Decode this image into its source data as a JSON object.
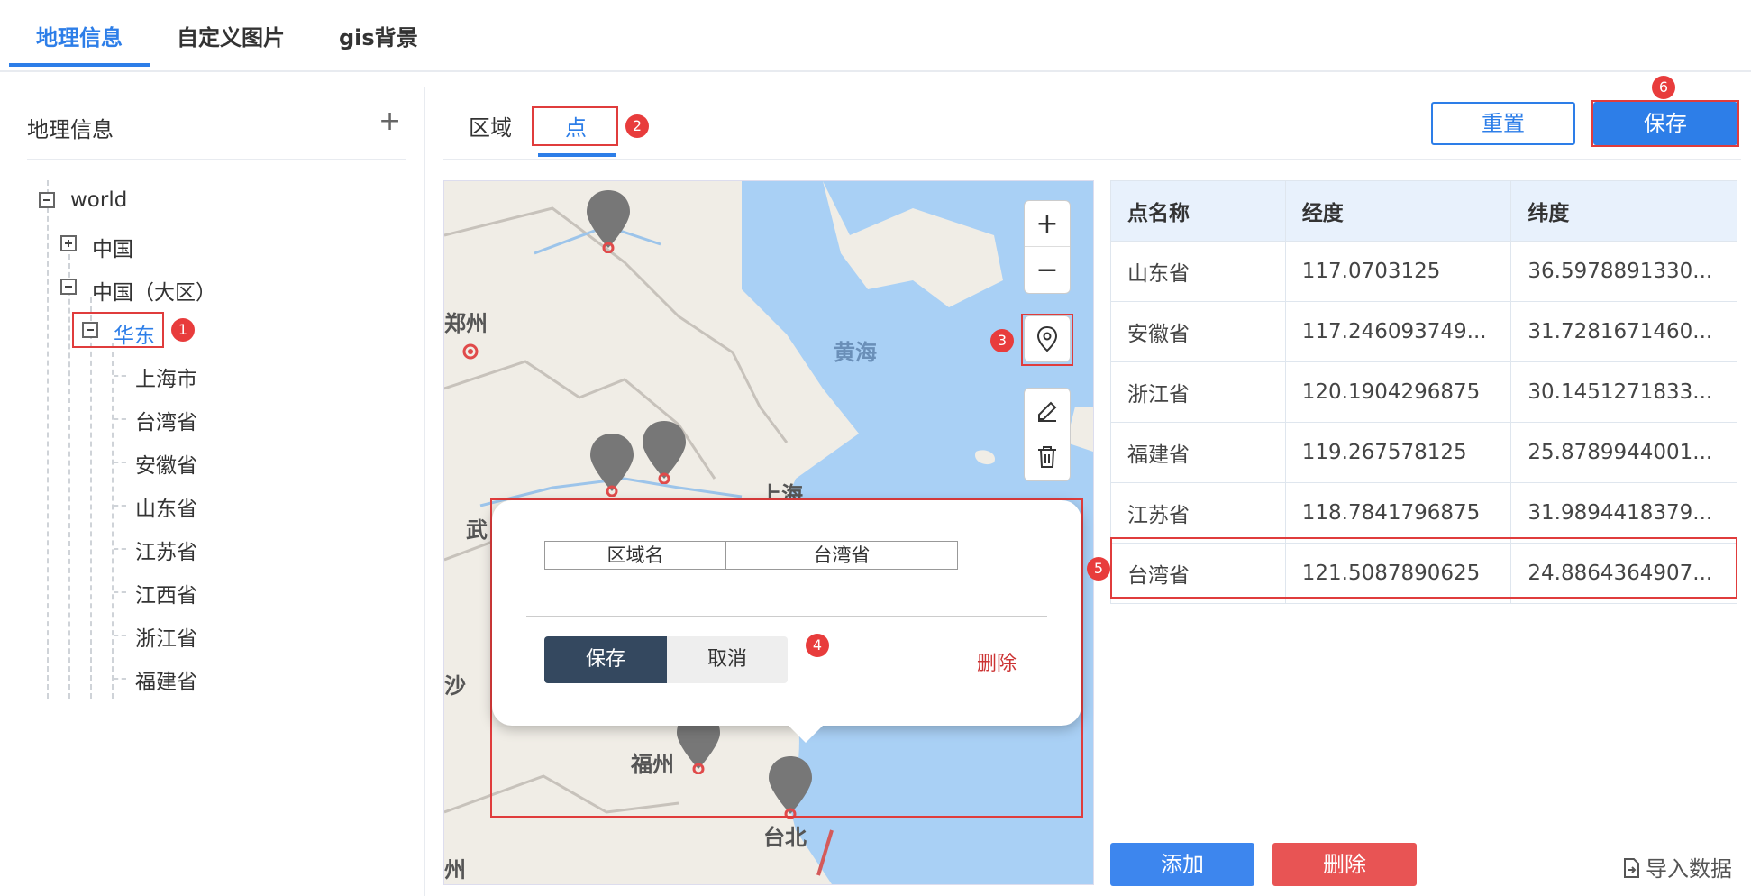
{
  "top_tabs": [
    {
      "label": "地理信息",
      "active": true
    },
    {
      "label": "自定义图片",
      "active": false
    },
    {
      "label": "gis背景",
      "active": false
    }
  ],
  "left_panel": {
    "title": "地理信息",
    "add_icon": "plus-icon",
    "tree": {
      "root": "world",
      "china": "中国",
      "china_region": "中国（大区）",
      "east_china": "华东",
      "children": [
        "上海市",
        "台湾省",
        "安徽省",
        "山东省",
        "江苏省",
        "江西省",
        "浙江省",
        "福建省"
      ]
    }
  },
  "sub_tabs": [
    {
      "label": "区域",
      "active": false
    },
    {
      "label": "点",
      "active": true
    }
  ],
  "buttons": {
    "reset": "重置",
    "save": "保存",
    "add": "添加",
    "delete": "删除",
    "import": "导入数据"
  },
  "map": {
    "labels": [
      "郑州",
      "黄海",
      "上海",
      "武",
      "沙",
      "福州",
      "台北",
      "州"
    ],
    "controls": [
      "plus-icon",
      "minus-icon",
      "map-pin-icon",
      "pencil-icon",
      "trash-icon"
    ]
  },
  "popup": {
    "field_label": "区域名",
    "field_value": "台湾省",
    "save": "保存",
    "cancel": "取消",
    "delete": "删除"
  },
  "table": {
    "headers": [
      "点名称",
      "经度",
      "纬度"
    ],
    "rows": [
      [
        "山东省",
        "117.0703125",
        "36.5978891330..."
      ],
      [
        "安徽省",
        "117.246093749...",
        "31.7281671460..."
      ],
      [
        "浙江省",
        "120.1904296875",
        "30.1451271833..."
      ],
      [
        "福建省",
        "119.267578125",
        "25.8789944001..."
      ],
      [
        "江苏省",
        "118.7841796875",
        "31.9894418379..."
      ],
      [
        "台湾省",
        "121.5087890625",
        "24.8864364907..."
      ]
    ]
  },
  "step_badges": [
    "1",
    "2",
    "3",
    "4",
    "5",
    "6"
  ],
  "colors": {
    "accent": "#2d7ee8",
    "danger": "#e85454",
    "annotation": "#e03c3c",
    "popup_save": "#34485f"
  }
}
